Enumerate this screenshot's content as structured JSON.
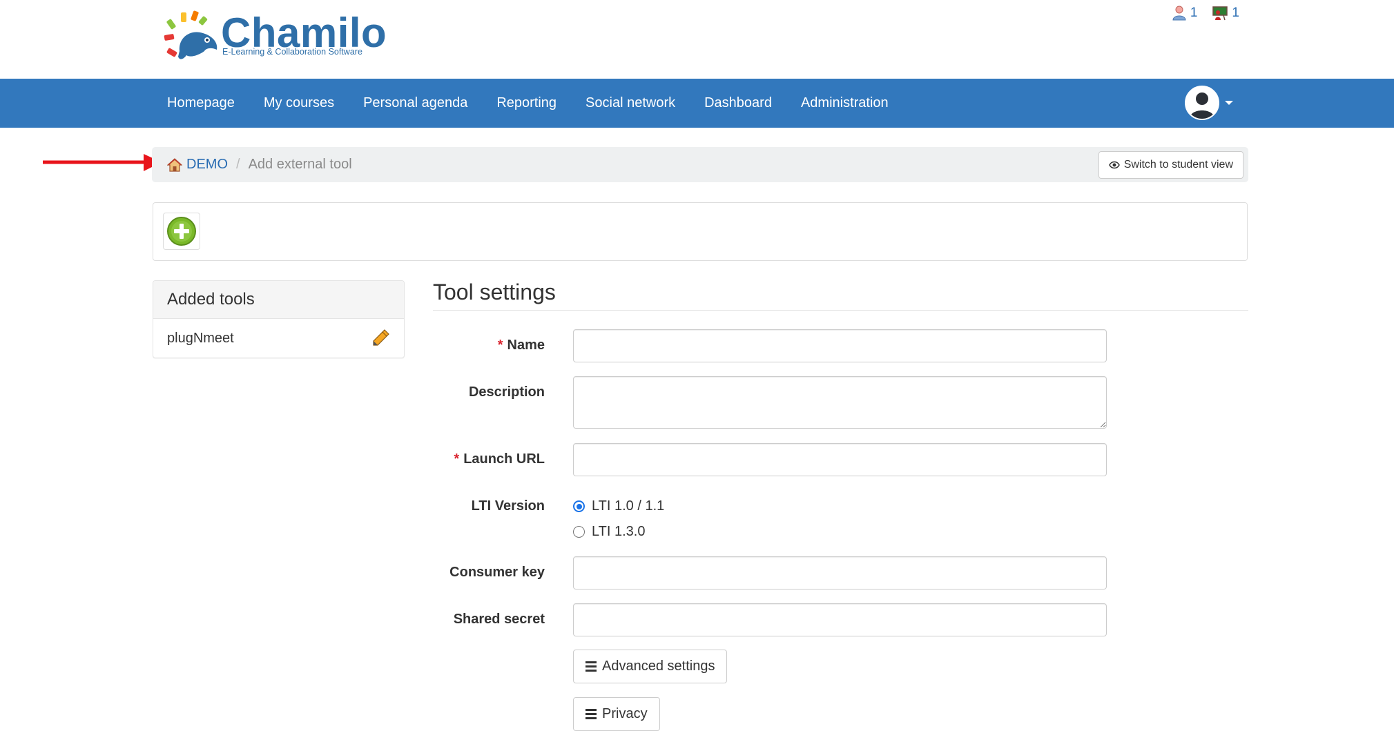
{
  "header": {
    "logo_text": "Chamilo",
    "logo_subtext": "E-Learning & Collaboration Software",
    "users_online_count": "1",
    "course_users_count": "1"
  },
  "nav": {
    "items": [
      "Homepage",
      "My courses",
      "Personal agenda",
      "Reporting",
      "Social network",
      "Dashboard",
      "Administration"
    ]
  },
  "breadcrumb": {
    "home_label": "DEMO",
    "separator": "/",
    "current": "Add external tool"
  },
  "actions": {
    "switch_view_label": "Switch to student view"
  },
  "sidebar": {
    "title": "Added tools",
    "tools": [
      {
        "name": "plugNmeet"
      }
    ]
  },
  "form": {
    "title": "Tool settings",
    "required_mark": "*",
    "name_label": "Name",
    "name_value": "",
    "description_label": "Description",
    "description_value": "",
    "launch_url_label": "Launch URL",
    "launch_url_value": "",
    "lti_version_label": "LTI Version",
    "lti_options": [
      "LTI 1.0 / 1.1",
      "LTI 1.3.0"
    ],
    "lti_selected": "LTI 1.0 / 1.1",
    "consumer_key_label": "Consumer key",
    "consumer_key_value": "",
    "shared_secret_label": "Shared secret",
    "shared_secret_value": "",
    "advanced_label": "Advanced settings",
    "privacy_label": "Privacy"
  },
  "colors": {
    "navbar": "#3278bd",
    "link": "#2a6db3",
    "required": "#d9232e",
    "annotation_arrow": "#e8141b",
    "add_icon": "#8cc63f"
  },
  "icons": {
    "users_online": "user-icon",
    "course_users": "teacher-board-icon",
    "home": "home-icon",
    "switch_view": "eye-icon",
    "add": "plus-circle-icon",
    "edit": "pencil-icon",
    "menu": "bars-icon"
  }
}
